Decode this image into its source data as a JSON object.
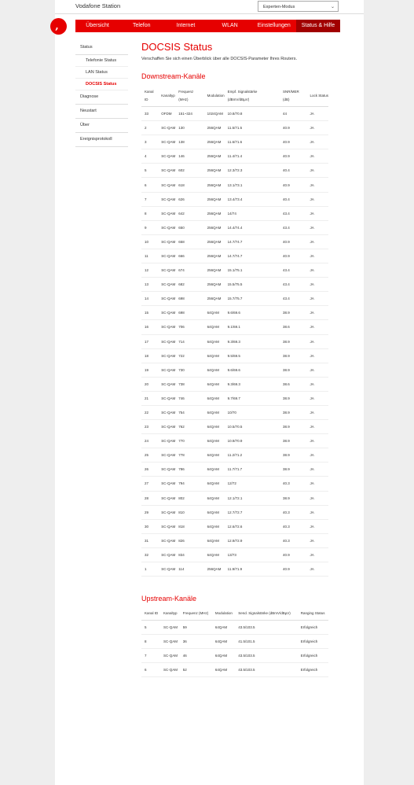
{
  "header": {
    "station_title": "Vodafone Station",
    "mode_value": "Experten-Modus"
  },
  "nav": [
    {
      "label": "Übersicht"
    },
    {
      "label": "Telefon"
    },
    {
      "label": "Internet"
    },
    {
      "label": "WLAN"
    },
    {
      "label": "Einstellungen"
    },
    {
      "label": "Status & Hilfe"
    }
  ],
  "sidebar": {
    "status": "Status",
    "subitems": [
      {
        "label": "Telefonie Status"
      },
      {
        "label": "LAN Status"
      },
      {
        "label": "DOCSIS Status"
      }
    ],
    "items": [
      {
        "label": "Diagnose"
      },
      {
        "label": "Neustart"
      },
      {
        "label": "Über"
      },
      {
        "label": "Ereignisprotokoll"
      }
    ]
  },
  "page": {
    "title": "DOCSIS Status",
    "intro": "Verschaffen Sie sich einen Überblick über alle DOCSIS-Parameter Ihres Routers."
  },
  "downstream": {
    "title": "Downstream-Kanäle",
    "headers": [
      "Kanal ID",
      "Kanaltyp",
      "Frequenz (MHz)",
      "Modulation",
      "Empf. Signalstärke (dBmV/dBµV)",
      "SNR/MER (dB)",
      "Lock Status"
    ],
    "rows": [
      [
        "33",
        "OFDM",
        "151~324",
        "1024QAM",
        "10.8/70.8",
        "44",
        "JA"
      ],
      [
        "2",
        "SC-QAM",
        "130",
        "256QAM",
        "11.5/71.5",
        "40.9",
        "JA"
      ],
      [
        "3",
        "SC-QAM",
        "138",
        "256QAM",
        "11.6/71.6",
        "40.9",
        "JA"
      ],
      [
        "4",
        "SC-QAM",
        "146",
        "256QAM",
        "11.4/71.4",
        "40.9",
        "JA"
      ],
      [
        "5",
        "SC-QAM",
        "602",
        "256QAM",
        "12.3/72.3",
        "40.4",
        "JA"
      ],
      [
        "6",
        "SC-QAM",
        "618",
        "256QAM",
        "13.1/73.1",
        "40.9",
        "JA"
      ],
      [
        "7",
        "SC-QAM",
        "626",
        "256QAM",
        "13.4/73.4",
        "40.4",
        "JA"
      ],
      [
        "8",
        "SC-QAM",
        "642",
        "256QAM",
        "14/74",
        "43.4",
        "JA"
      ],
      [
        "9",
        "SC-QAM",
        "650",
        "256QAM",
        "14.4/74.4",
        "43.4",
        "JA"
      ],
      [
        "10",
        "SC-QAM",
        "658",
        "256QAM",
        "14.7/74.7",
        "40.9",
        "JA"
      ],
      [
        "11",
        "SC-QAM",
        "666",
        "256QAM",
        "14.7/74.7",
        "40.9",
        "JA"
      ],
      [
        "12",
        "SC-QAM",
        "674",
        "256QAM",
        "15.1/75.1",
        "43.4",
        "JA"
      ],
      [
        "13",
        "SC-QAM",
        "682",
        "256QAM",
        "15.5/75.5",
        "43.4",
        "JA"
      ],
      [
        "14",
        "SC-QAM",
        "698",
        "256QAM",
        "15.7/75.7",
        "43.4",
        "JA"
      ],
      [
        "15",
        "SC-QAM",
        "698",
        "64QAM",
        "9.6/69.6",
        "38.9",
        "JA"
      ],
      [
        "16",
        "SC-QAM",
        "706",
        "64QAM",
        "9.1/69.1",
        "38.6",
        "JA"
      ],
      [
        "17",
        "SC-QAM",
        "714",
        "64QAM",
        "9.3/69.3",
        "38.9",
        "JA"
      ],
      [
        "18",
        "SC-QAM",
        "722",
        "64QAM",
        "9.5/69.5",
        "38.9",
        "JA"
      ],
      [
        "19",
        "SC-QAM",
        "730",
        "64QAM",
        "9.6/69.6",
        "38.9",
        "JA"
      ],
      [
        "20",
        "SC-QAM",
        "738",
        "64QAM",
        "9.3/69.3",
        "38.6",
        "JA"
      ],
      [
        "21",
        "SC-QAM",
        "746",
        "64QAM",
        "9.7/69.7",
        "38.9",
        "JA"
      ],
      [
        "22",
        "SC-QAM",
        "754",
        "64QAM",
        "10/70",
        "38.9",
        "JA"
      ],
      [
        "23",
        "SC-QAM",
        "762",
        "64QAM",
        "10.5/70.5",
        "38.9",
        "JA"
      ],
      [
        "24",
        "SC-QAM",
        "770",
        "64QAM",
        "10.9/70.9",
        "38.9",
        "JA"
      ],
      [
        "25",
        "SC-QAM",
        "778",
        "64QAM",
        "11.2/71.2",
        "38.9",
        "JA"
      ],
      [
        "26",
        "SC-QAM",
        "786",
        "64QAM",
        "11.7/71.7",
        "38.9",
        "JA"
      ],
      [
        "27",
        "SC-QAM",
        "794",
        "64QAM",
        "12/72",
        "40.3",
        "JA"
      ],
      [
        "28",
        "SC-QAM",
        "802",
        "64QAM",
        "12.1/72.1",
        "38.9",
        "JA"
      ],
      [
        "29",
        "SC-QAM",
        "810",
        "64QAM",
        "12.7/72.7",
        "40.3",
        "JA"
      ],
      [
        "30",
        "SC-QAM",
        "818",
        "64QAM",
        "12.6/72.6",
        "40.3",
        "JA"
      ],
      [
        "31",
        "SC-QAM",
        "826",
        "64QAM",
        "12.9/72.9",
        "40.3",
        "JA"
      ],
      [
        "32",
        "SC-QAM",
        "834",
        "64QAM",
        "13/73",
        "40.9",
        "JA"
      ],
      [
        "1",
        "SC-QAM",
        "114",
        "256QAM",
        "11.9/71.9",
        "40.9",
        "JA"
      ]
    ]
  },
  "upstream": {
    "title": "Upstream-Kanäle",
    "headers": [
      "Kanal ID",
      "Kanaltyp",
      "Frequenz (MHz)",
      "Modulation",
      "Send. Signalstärke (dBmV/dBµV)",
      "Ranging Status"
    ],
    "rows": [
      [
        "5",
        "SC-QAM",
        "59",
        "64QAM",
        "43.5/103.5",
        "Erfolgreich"
      ],
      [
        "8",
        "SC-QAM",
        "36",
        "64QAM",
        "41.5/101.5",
        "Erfolgreich"
      ],
      [
        "7",
        "SC-QAM",
        "46",
        "64QAM",
        "43.5/103.5",
        "Erfolgreich"
      ],
      [
        "6",
        "SC-QAM",
        "52",
        "64QAM",
        "43.5/103.5",
        "Erfolgreich"
      ]
    ]
  },
  "colors": {
    "accent": "#e60000",
    "accent_dark": "#a10000"
  },
  "icons": {
    "logo": "vodafone-logo",
    "select": "chevron-down-icon"
  }
}
